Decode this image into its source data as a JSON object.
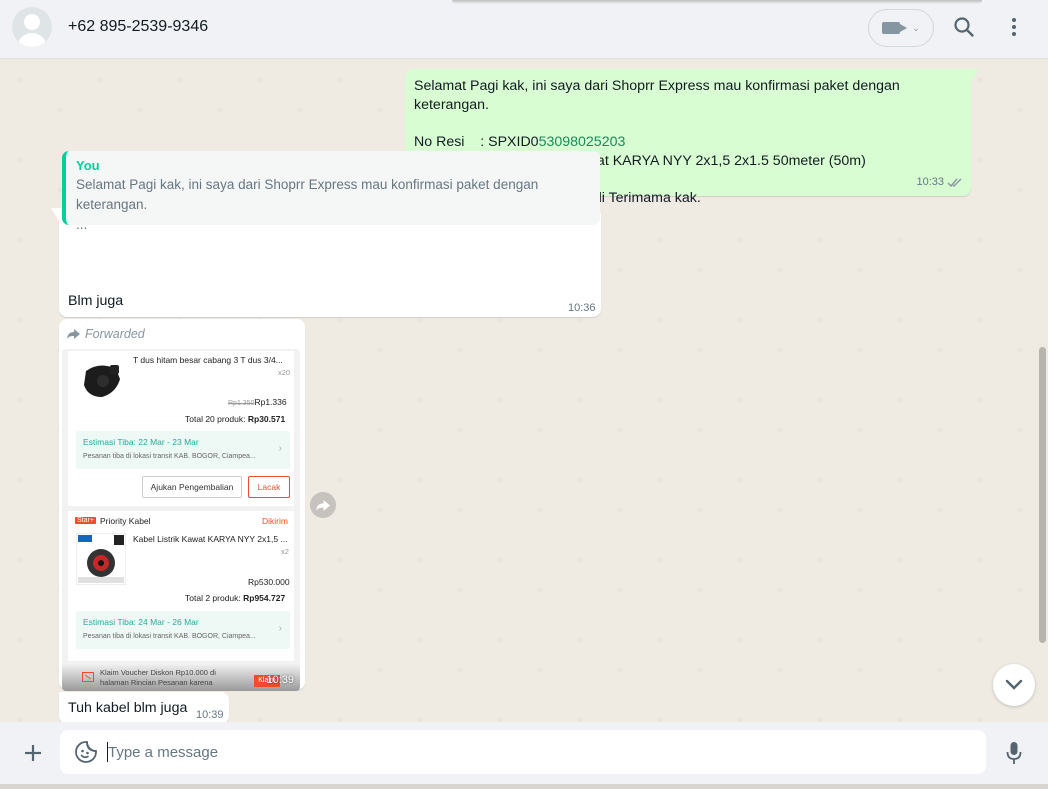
{
  "header": {
    "contact_name": "+62 895-2539-9346"
  },
  "messages": {
    "outgoing": {
      "line1": "Selamat Pagi kak, ini saya dari Shoprr Express mau konfirmasi paket dengan keterangan.",
      "resi_label": "No Resi    : SPXID0",
      "resi_number": "53098025203",
      "isi_paket": "Isi Paket   : Kabel Listrik Kawat KARYA NYY 2x1,5 2x1.5 50meter (50m)",
      "line_last": "Apakah pesanan nya sudah di Terimama kak.",
      "time": "10:33"
    },
    "reply": {
      "quote_author": "You",
      "quote_text": "Selamat Pagi kak, ini saya dari Shoprr Express mau konfirmasi paket dengan keterangan.",
      "quote_more": "...",
      "text": "Blm juga",
      "time": "10:36"
    },
    "forwarded": {
      "label": "Forwarded",
      "time": "10:39",
      "item1": {
        "name": "T dus hitam besar cabang 3 T dus 3/4...",
        "qty": "x20",
        "old_price": "Rp1.350",
        "price": "Rp1.336",
        "total_label": "Total 20 produk: ",
        "total_value": "Rp30.571",
        "eta_title": "Estimasi Tiba: 22 Mar - 23 Mar",
        "eta_sub": "Pesanan tiba di lokasi transit KAB. BOGOR, Ciampea...",
        "btn_return": "Ajukan Pengembalian",
        "btn_track": "Lacak"
      },
      "item2": {
        "shop_tag": "Star+",
        "shop_name": "Priority Kabel",
        "status": "Dikirim",
        "name": "Kabel Listrik Kawat KARYA NYY 2x1,5 ...",
        "qty": "x2",
        "price": "Rp530.000",
        "total_label": "Total 2 produk: ",
        "total_value": "Rp954.727",
        "eta_title": "Estimasi Tiba: 24 Mar - 26 Mar",
        "eta_sub": "Pesanan tiba di lokasi transit KAB. BOGOR, Ciampea..."
      },
      "voucher_line1": "Klaim Voucher Diskon Rp10.000 di",
      "voucher_line2": "halaman Rincian Pesanan karena",
      "voucher_btn": "Klaim"
    },
    "last": {
      "text": "Tuh kabel blm juga",
      "time": "10:39"
    }
  },
  "footer": {
    "placeholder": "Type a message"
  },
  "colors": {
    "outgoing_bubble": "#d9fdd3",
    "accent_green": "#06cf9c",
    "chat_bg": "#efeae2"
  }
}
